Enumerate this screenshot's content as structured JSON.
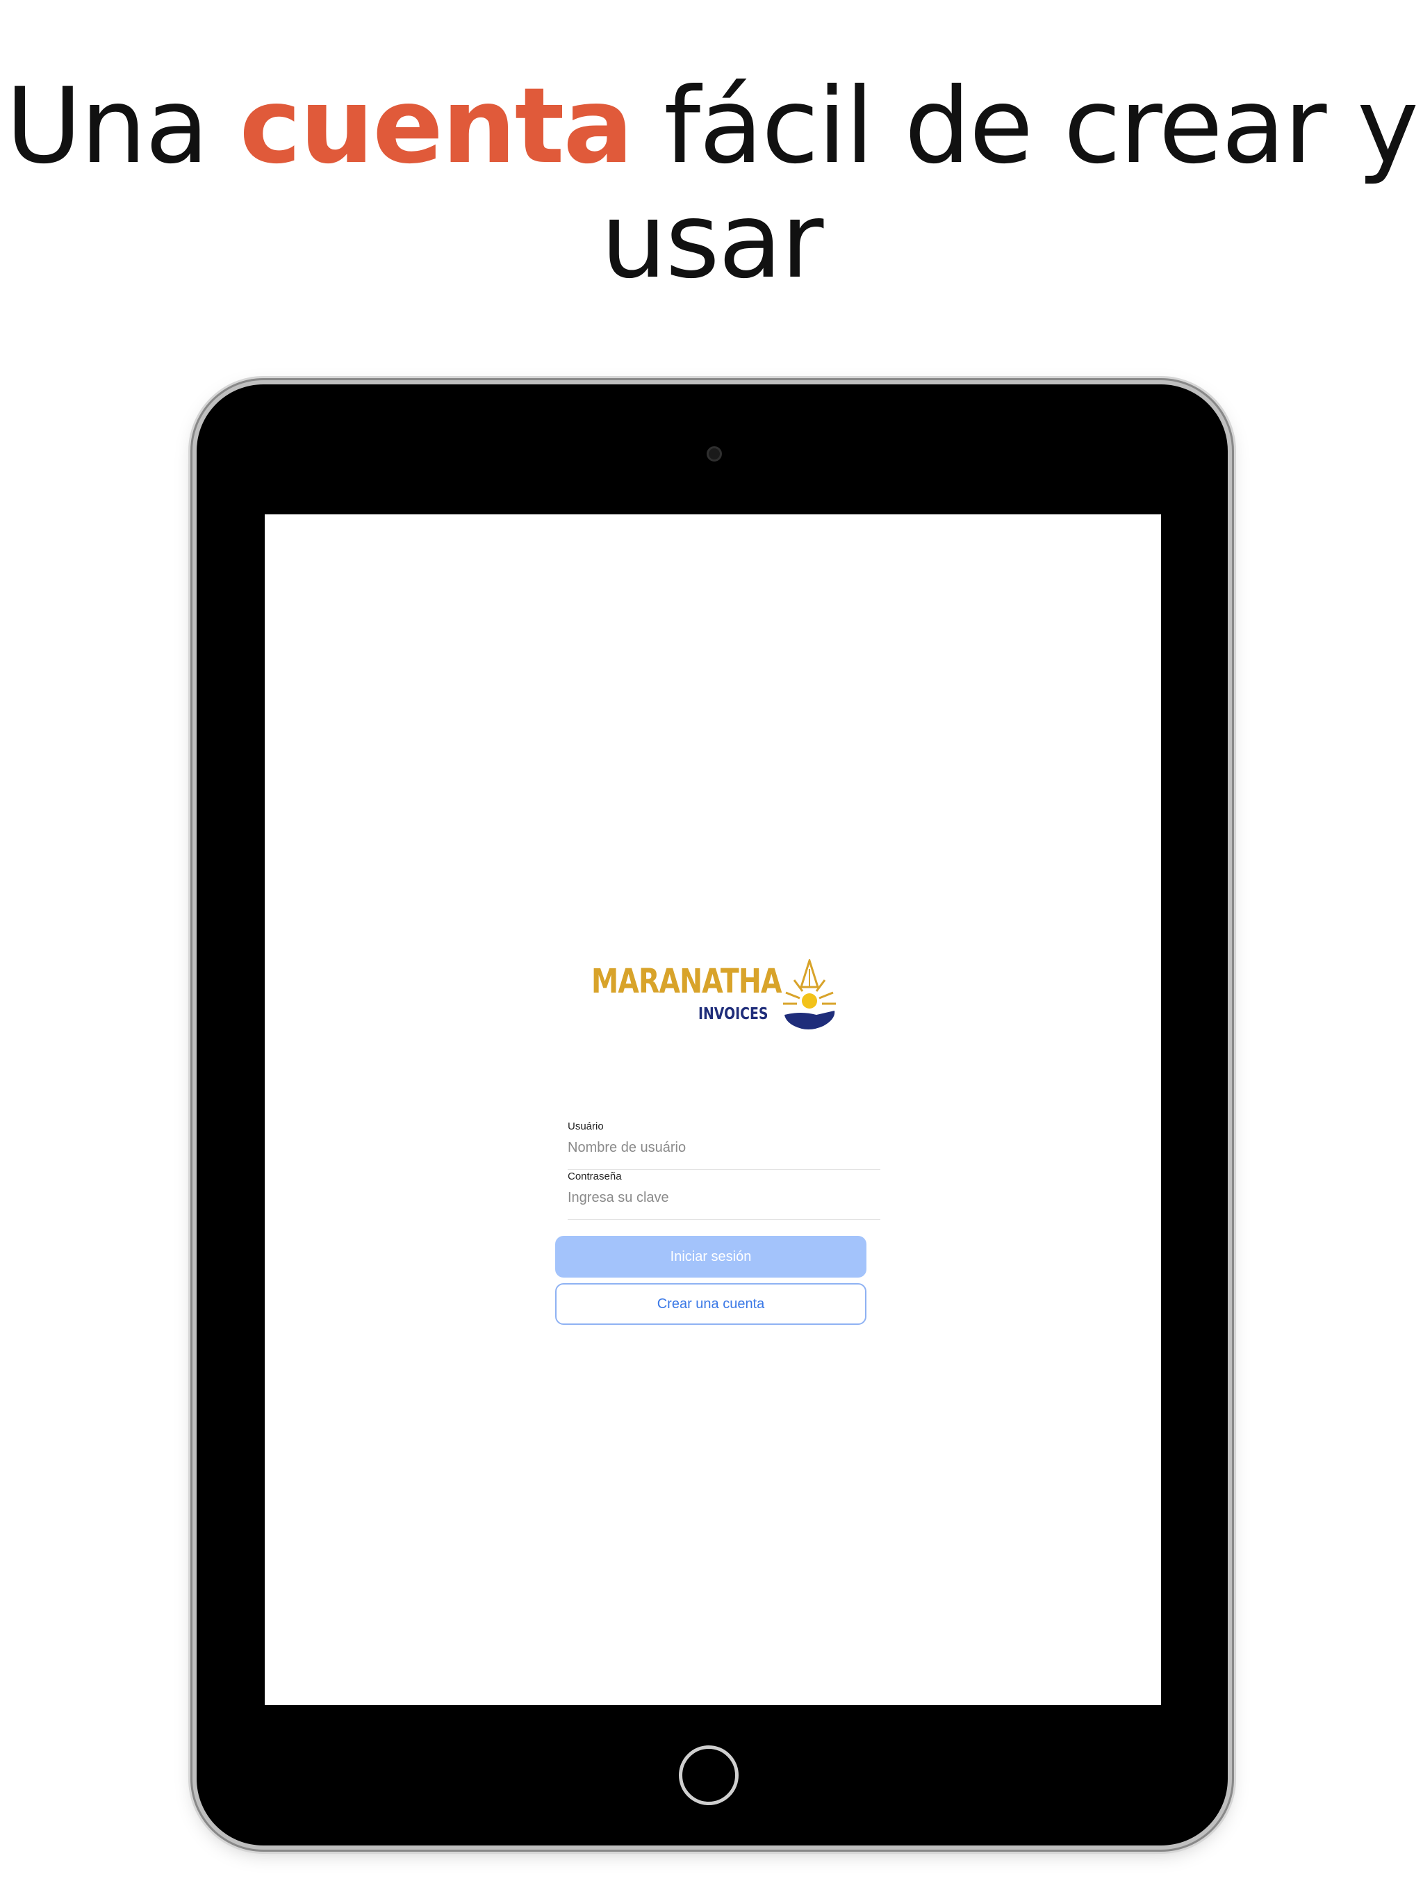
{
  "headline": {
    "part1": "Una ",
    "accent": "cuenta",
    "part2": " fácil de crear y usar"
  },
  "logo": {
    "title": "MARANATHA",
    "subtitle": "INVOICES"
  },
  "form": {
    "username_label": "Usuário",
    "username_placeholder": "Nombre de usuário",
    "password_label": "Contraseña",
    "password_placeholder": "Ingresa su clave"
  },
  "buttons": {
    "login_label": "Iniciar sesión",
    "create_account_label": "Crear una cuenta"
  },
  "colors": {
    "accent": "#e05a3a",
    "logo_gold": "#d8a32a",
    "logo_navy": "#1f2d7a",
    "primary_button": "#a3c3fb",
    "link_blue": "#3a78e6"
  }
}
